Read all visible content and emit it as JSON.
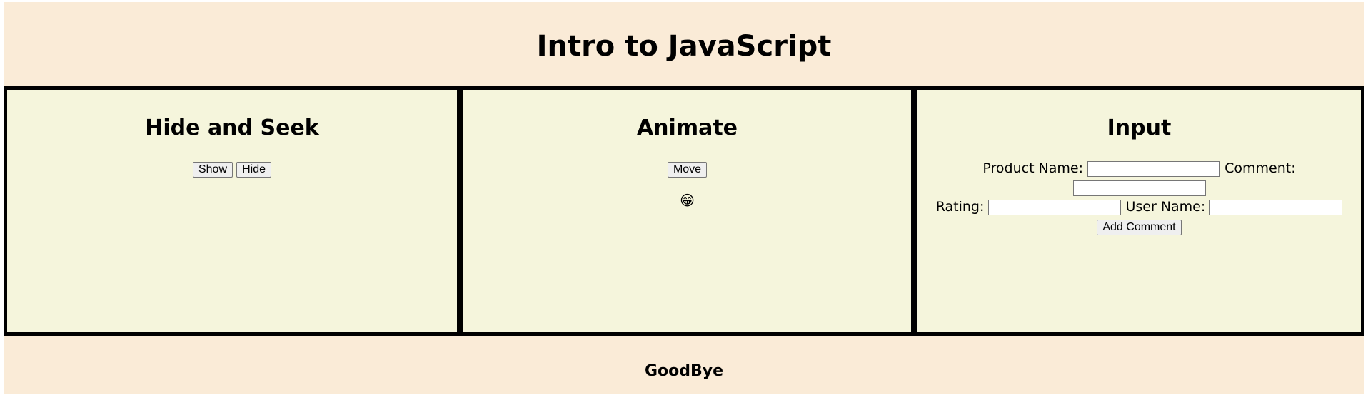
{
  "header": {
    "title": "Intro to JavaScript"
  },
  "panels": {
    "hide_seek": {
      "title": "Hide and Seek",
      "show_label": "Show",
      "hide_label": "Hide"
    },
    "animate": {
      "title": "Animate",
      "move_label": "Move",
      "emoji_icon": "grinning-face-emoji",
      "emoji": "😁"
    },
    "input": {
      "title": "Input",
      "product_name_label": "Product Name:",
      "product_name_value": "",
      "comment_label": "Comment:",
      "comment_value": "",
      "rating_label": "Rating:",
      "rating_value": "",
      "user_name_label": "User Name:",
      "user_name_value": "",
      "add_comment_label": "Add Comment"
    }
  },
  "footer": {
    "text": "GoodBye"
  },
  "colors": {
    "page_bg": "#faebd7",
    "panel_bg": "#f5f5dc",
    "border": "#000000"
  }
}
